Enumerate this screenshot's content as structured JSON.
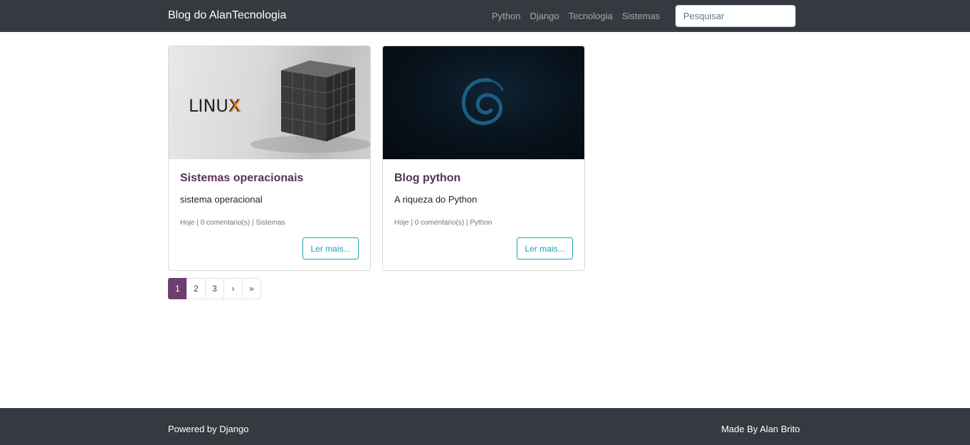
{
  "navbar": {
    "brand": "Blog do AlanTecnologia",
    "links": [
      "Python",
      "Django",
      "Tecnologia",
      "Sistemas"
    ],
    "search_placeholder": "Pesquisar"
  },
  "posts": [
    {
      "title": "Sistemas operacionais",
      "text": "sistema operacional",
      "meta": "Hoje | 0 comentario(s) | Sistemas",
      "button": "Ler mais...",
      "image_logo": "LINUX"
    },
    {
      "title": "Blog python",
      "text": "A riqueza do Python",
      "meta": "Hoje | 0 comentario(s) | Python",
      "button": "Ler mais..."
    }
  ],
  "pagination": [
    "1",
    "2",
    "3",
    "›",
    "»"
  ],
  "footer": {
    "left": "Powered by Django",
    "right": "Made By Alan Brito"
  },
  "colors": {
    "navbar": "#343a40",
    "accent": "#6d3f6e",
    "button": "#17a2b8"
  }
}
